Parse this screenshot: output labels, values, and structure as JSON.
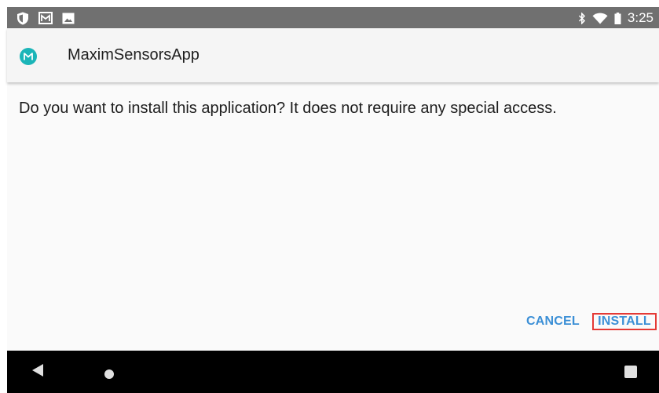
{
  "status_bar": {
    "left_icons": [
      "shield-icon",
      "gallery-icon",
      "image-icon"
    ],
    "right_icons": [
      "bluetooth-icon",
      "wifi-icon",
      "battery-icon"
    ],
    "time": "3:25",
    "background": "#707070"
  },
  "app": {
    "title": "MaximSensorsApp",
    "logo_icon": "maxim-logo-icon",
    "logo_color": "#1bb5b8"
  },
  "dialog": {
    "message": "Do you want to install this application? It does not require any special access.",
    "cancel_label": "CANCEL",
    "install_label": "INSTALL",
    "button_color": "#3b8fd6",
    "highlight_color": "#e53935"
  },
  "nav_bar": {
    "icons": [
      "back-icon",
      "home-icon",
      "recents-icon"
    ]
  }
}
